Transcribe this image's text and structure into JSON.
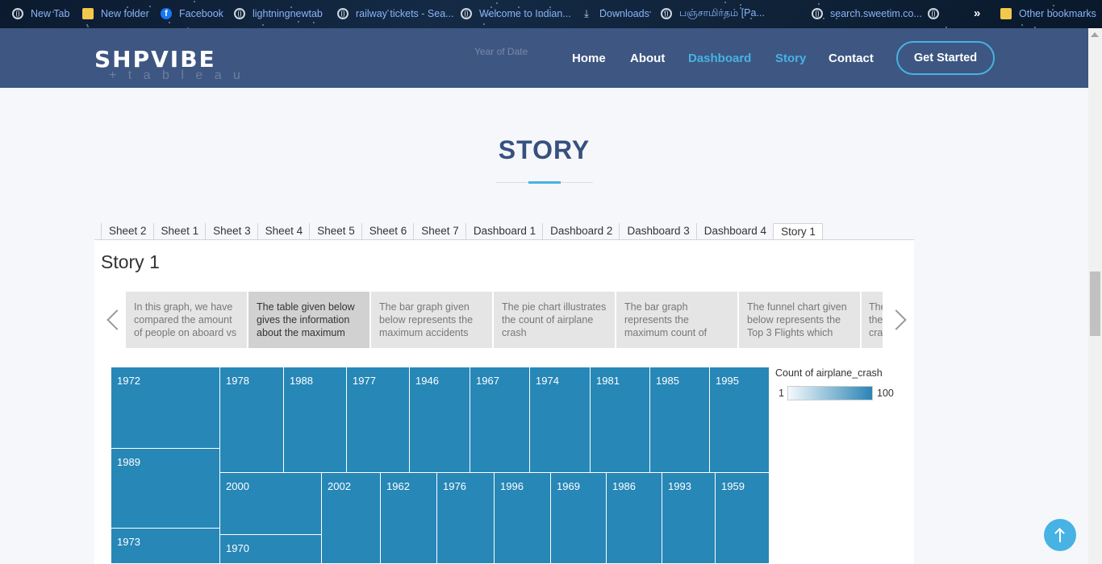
{
  "bookmarks": {
    "items": [
      {
        "label": "New Tab",
        "icon": "globe-icon"
      },
      {
        "label": "New folder",
        "icon": "folder-icon"
      },
      {
        "label": "Facebook",
        "icon": "facebook-icon"
      },
      {
        "label": "lightningnewtab",
        "icon": "globe-icon"
      },
      {
        "label": "railway tickets - Sea...",
        "icon": "globe-icon"
      },
      {
        "label": "Welcome to Indian...",
        "icon": "globe-icon"
      },
      {
        "label": "Downloads",
        "icon": "download-icon"
      },
      {
        "label": "பஞ்சாமிர்தம் [Pa...",
        "icon": "globe-icon"
      },
      {
        "label": "search.sweetim.co...",
        "icon": "globe-icon"
      }
    ],
    "more_label": "»",
    "other_label": "Other bookmarks"
  },
  "header": {
    "logo": "SHPVIBE",
    "ghost_axis_label": "Year of Date",
    "ghost_tableau": "+ t a b l e a u",
    "nav": [
      {
        "label": "Home",
        "active": false
      },
      {
        "label": "About",
        "active": false
      },
      {
        "label": "Dashboard",
        "active": true
      },
      {
        "label": "Story",
        "active": true
      },
      {
        "label": "Contact",
        "active": false
      }
    ],
    "cta": "Get Started",
    "accent_color": "#47b2e4",
    "nav_bg": "#37517e"
  },
  "section": {
    "title": "STORY"
  },
  "viz": {
    "tabs": [
      "Sheet 2",
      "Sheet 1",
      "Sheet 3",
      "Sheet 4",
      "Sheet 5",
      "Sheet 6",
      "Sheet 7",
      "Dashboard 1",
      "Dashboard 2",
      "Dashboard 3",
      "Dashboard 4",
      "Story 1"
    ],
    "active_tab": "Story 1",
    "title": "Story 1",
    "story_points": [
      {
        "text": "In this graph, we have compared the amount of people on aboard vs",
        "active": false
      },
      {
        "text": "The table given below gives the information about the maximum",
        "active": true
      },
      {
        "text": "The bar graph given below represents the maximum accidents",
        "active": false
      },
      {
        "text": "The pie chart illustrates the count of airplane crash",
        "active": false
      },
      {
        "text": "The bar graph represents the maximum count of",
        "active": false
      },
      {
        "text": "The funnel chart given below represents the Top 3 Flights which",
        "active": false
      },
      {
        "text": "The the cra",
        "active": false
      }
    ],
    "treemap_cells": [
      "1972",
      "1978",
      "1988",
      "1977",
      "1946",
      "1967",
      "1974",
      "1981",
      "1985",
      "1995",
      "1989",
      "2000",
      "2002",
      "1962",
      "1976",
      "1996",
      "1969",
      "1986",
      "1993",
      "1959",
      "1973",
      "1970"
    ],
    "legend": {
      "title": "Count of airplane_crash",
      "min": "1",
      "max": "100",
      "color_low": "#f4f9fc",
      "color_high": "#2b84b5"
    }
  }
}
